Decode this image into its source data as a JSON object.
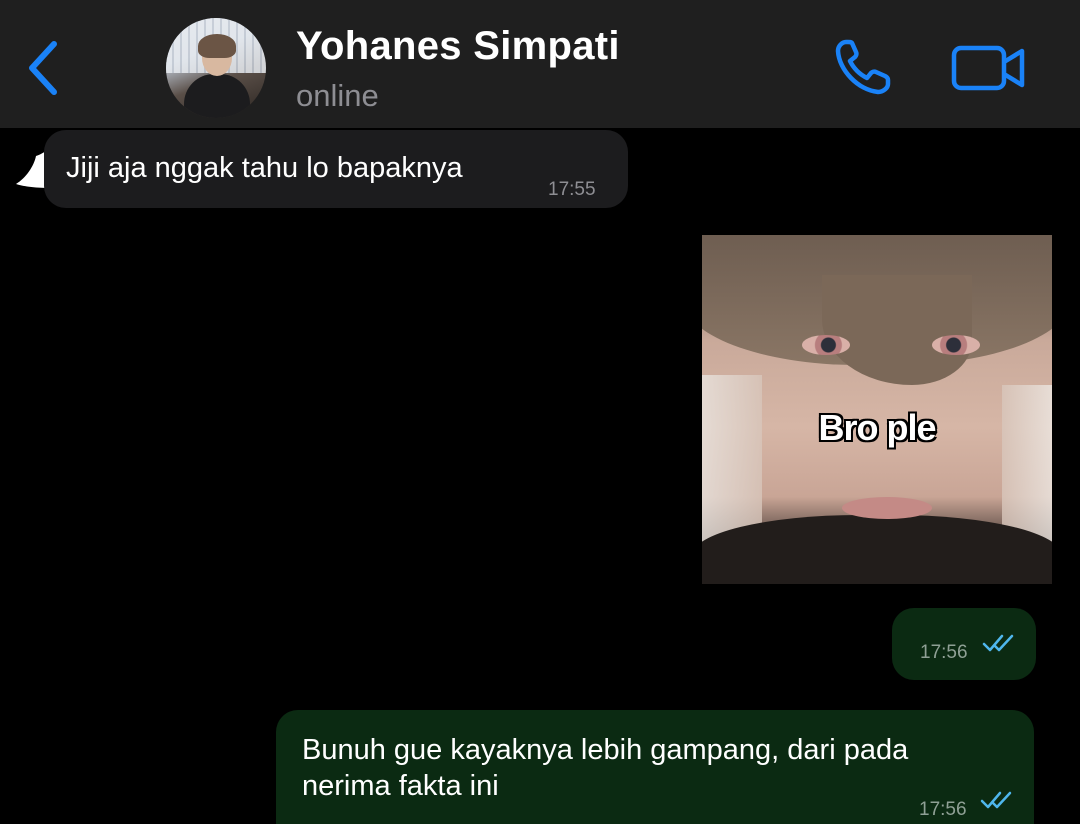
{
  "header": {
    "contact_name": "Yohanes Simpati",
    "status": "online",
    "back_icon": "chevron-left-icon",
    "call_icon": "phone-icon",
    "video_icon": "video-camera-icon",
    "accent_color": "#1a82f7"
  },
  "messages": [
    {
      "direction": "incoming",
      "text": "Jiji aja nggak tahu lo bapaknya",
      "time": "17:55"
    },
    {
      "direction": "outgoing",
      "type": "image",
      "caption": "Bro ple",
      "time": "17:56",
      "status": "read"
    },
    {
      "direction": "outgoing",
      "lines": [
        "Bunuh gue kayaknya lebih gampang, dari pada",
        "nerima fakta ini"
      ],
      "time": "17:56",
      "status": "read"
    }
  ],
  "colors": {
    "background": "#000000",
    "header": "#1f1f1f",
    "incoming_bubble": "#1c1c1e",
    "outgoing_bubble": "#0b2a12",
    "read_ticks": "#4fb6ec"
  }
}
